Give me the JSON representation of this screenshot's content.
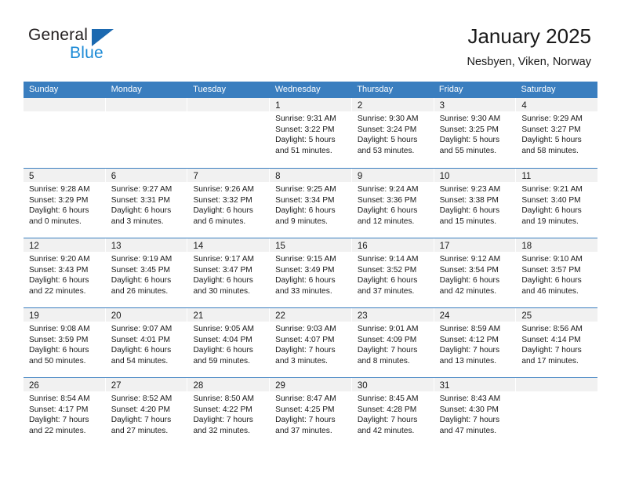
{
  "brand": {
    "name_top": "General",
    "name_bottom": "Blue",
    "logo_icon": "triangle-logo-icon"
  },
  "header": {
    "title": "January 2025",
    "subtitle": "Nesbyen, Viken, Norway"
  },
  "colors": {
    "header_blue": "#3a7ebf",
    "daynum_band": "#f1f1f1",
    "brand_dark": "#231f20",
    "brand_blue": "#1b8ad6",
    "logo_blue": "#1b69b0"
  },
  "calendar": {
    "weekday_headers": [
      "Sunday",
      "Monday",
      "Tuesday",
      "Wednesday",
      "Thursday",
      "Friday",
      "Saturday"
    ],
    "weeks": [
      [
        {
          "day": "",
          "lines": []
        },
        {
          "day": "",
          "lines": []
        },
        {
          "day": "",
          "lines": []
        },
        {
          "day": "1",
          "lines": [
            "Sunrise: 9:31 AM",
            "Sunset: 3:22 PM",
            "Daylight: 5 hours",
            "and 51 minutes."
          ]
        },
        {
          "day": "2",
          "lines": [
            "Sunrise: 9:30 AM",
            "Sunset: 3:24 PM",
            "Daylight: 5 hours",
            "and 53 minutes."
          ]
        },
        {
          "day": "3",
          "lines": [
            "Sunrise: 9:30 AM",
            "Sunset: 3:25 PM",
            "Daylight: 5 hours",
            "and 55 minutes."
          ]
        },
        {
          "day": "4",
          "lines": [
            "Sunrise: 9:29 AM",
            "Sunset: 3:27 PM",
            "Daylight: 5 hours",
            "and 58 minutes."
          ]
        }
      ],
      [
        {
          "day": "5",
          "lines": [
            "Sunrise: 9:28 AM",
            "Sunset: 3:29 PM",
            "Daylight: 6 hours",
            "and 0 minutes."
          ]
        },
        {
          "day": "6",
          "lines": [
            "Sunrise: 9:27 AM",
            "Sunset: 3:31 PM",
            "Daylight: 6 hours",
            "and 3 minutes."
          ]
        },
        {
          "day": "7",
          "lines": [
            "Sunrise: 9:26 AM",
            "Sunset: 3:32 PM",
            "Daylight: 6 hours",
            "and 6 minutes."
          ]
        },
        {
          "day": "8",
          "lines": [
            "Sunrise: 9:25 AM",
            "Sunset: 3:34 PM",
            "Daylight: 6 hours",
            "and 9 minutes."
          ]
        },
        {
          "day": "9",
          "lines": [
            "Sunrise: 9:24 AM",
            "Sunset: 3:36 PM",
            "Daylight: 6 hours",
            "and 12 minutes."
          ]
        },
        {
          "day": "10",
          "lines": [
            "Sunrise: 9:23 AM",
            "Sunset: 3:38 PM",
            "Daylight: 6 hours",
            "and 15 minutes."
          ]
        },
        {
          "day": "11",
          "lines": [
            "Sunrise: 9:21 AM",
            "Sunset: 3:40 PM",
            "Daylight: 6 hours",
            "and 19 minutes."
          ]
        }
      ],
      [
        {
          "day": "12",
          "lines": [
            "Sunrise: 9:20 AM",
            "Sunset: 3:43 PM",
            "Daylight: 6 hours",
            "and 22 minutes."
          ]
        },
        {
          "day": "13",
          "lines": [
            "Sunrise: 9:19 AM",
            "Sunset: 3:45 PM",
            "Daylight: 6 hours",
            "and 26 minutes."
          ]
        },
        {
          "day": "14",
          "lines": [
            "Sunrise: 9:17 AM",
            "Sunset: 3:47 PM",
            "Daylight: 6 hours",
            "and 30 minutes."
          ]
        },
        {
          "day": "15",
          "lines": [
            "Sunrise: 9:15 AM",
            "Sunset: 3:49 PM",
            "Daylight: 6 hours",
            "and 33 minutes."
          ]
        },
        {
          "day": "16",
          "lines": [
            "Sunrise: 9:14 AM",
            "Sunset: 3:52 PM",
            "Daylight: 6 hours",
            "and 37 minutes."
          ]
        },
        {
          "day": "17",
          "lines": [
            "Sunrise: 9:12 AM",
            "Sunset: 3:54 PM",
            "Daylight: 6 hours",
            "and 42 minutes."
          ]
        },
        {
          "day": "18",
          "lines": [
            "Sunrise: 9:10 AM",
            "Sunset: 3:57 PM",
            "Daylight: 6 hours",
            "and 46 minutes."
          ]
        }
      ],
      [
        {
          "day": "19",
          "lines": [
            "Sunrise: 9:08 AM",
            "Sunset: 3:59 PM",
            "Daylight: 6 hours",
            "and 50 minutes."
          ]
        },
        {
          "day": "20",
          "lines": [
            "Sunrise: 9:07 AM",
            "Sunset: 4:01 PM",
            "Daylight: 6 hours",
            "and 54 minutes."
          ]
        },
        {
          "day": "21",
          "lines": [
            "Sunrise: 9:05 AM",
            "Sunset: 4:04 PM",
            "Daylight: 6 hours",
            "and 59 minutes."
          ]
        },
        {
          "day": "22",
          "lines": [
            "Sunrise: 9:03 AM",
            "Sunset: 4:07 PM",
            "Daylight: 7 hours",
            "and 3 minutes."
          ]
        },
        {
          "day": "23",
          "lines": [
            "Sunrise: 9:01 AM",
            "Sunset: 4:09 PM",
            "Daylight: 7 hours",
            "and 8 minutes."
          ]
        },
        {
          "day": "24",
          "lines": [
            "Sunrise: 8:59 AM",
            "Sunset: 4:12 PM",
            "Daylight: 7 hours",
            "and 13 minutes."
          ]
        },
        {
          "day": "25",
          "lines": [
            "Sunrise: 8:56 AM",
            "Sunset: 4:14 PM",
            "Daylight: 7 hours",
            "and 17 minutes."
          ]
        }
      ],
      [
        {
          "day": "26",
          "lines": [
            "Sunrise: 8:54 AM",
            "Sunset: 4:17 PM",
            "Daylight: 7 hours",
            "and 22 minutes."
          ]
        },
        {
          "day": "27",
          "lines": [
            "Sunrise: 8:52 AM",
            "Sunset: 4:20 PM",
            "Daylight: 7 hours",
            "and 27 minutes."
          ]
        },
        {
          "day": "28",
          "lines": [
            "Sunrise: 8:50 AM",
            "Sunset: 4:22 PM",
            "Daylight: 7 hours",
            "and 32 minutes."
          ]
        },
        {
          "day": "29",
          "lines": [
            "Sunrise: 8:47 AM",
            "Sunset: 4:25 PM",
            "Daylight: 7 hours",
            "and 37 minutes."
          ]
        },
        {
          "day": "30",
          "lines": [
            "Sunrise: 8:45 AM",
            "Sunset: 4:28 PM",
            "Daylight: 7 hours",
            "and 42 minutes."
          ]
        },
        {
          "day": "31",
          "lines": [
            "Sunrise: 8:43 AM",
            "Sunset: 4:30 PM",
            "Daylight: 7 hours",
            "and 47 minutes."
          ]
        },
        {
          "day": "",
          "lines": []
        }
      ]
    ]
  }
}
